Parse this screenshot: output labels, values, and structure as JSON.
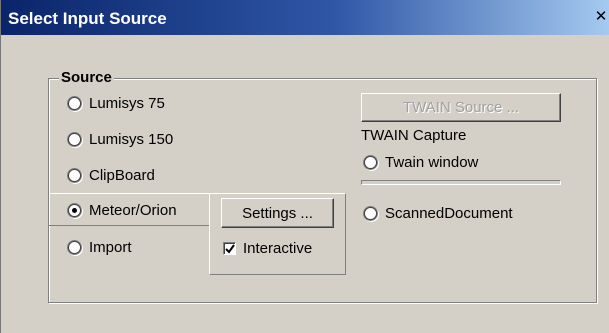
{
  "window": {
    "title": "Select Input Source",
    "close_glyph": "✕"
  },
  "source_group": {
    "legend": "Source",
    "options": [
      "Lumisys 75",
      "Lumisys 150",
      "ClipBoard",
      "Meteor/Orion",
      "Import"
    ],
    "selected": "Meteor/Orion"
  },
  "settings_button": "Settings ...",
  "interactive": {
    "label": "Interactive",
    "checked": true
  },
  "twain": {
    "source_button": "TWAIN Source ...",
    "capture_label": "TWAIN Capture",
    "options": [
      "Twain window",
      "ScannedDocument"
    ]
  },
  "icons": {
    "radio_selected": "radio-dot-icon",
    "checkbox_checked": "check-icon",
    "close": "close-icon"
  }
}
